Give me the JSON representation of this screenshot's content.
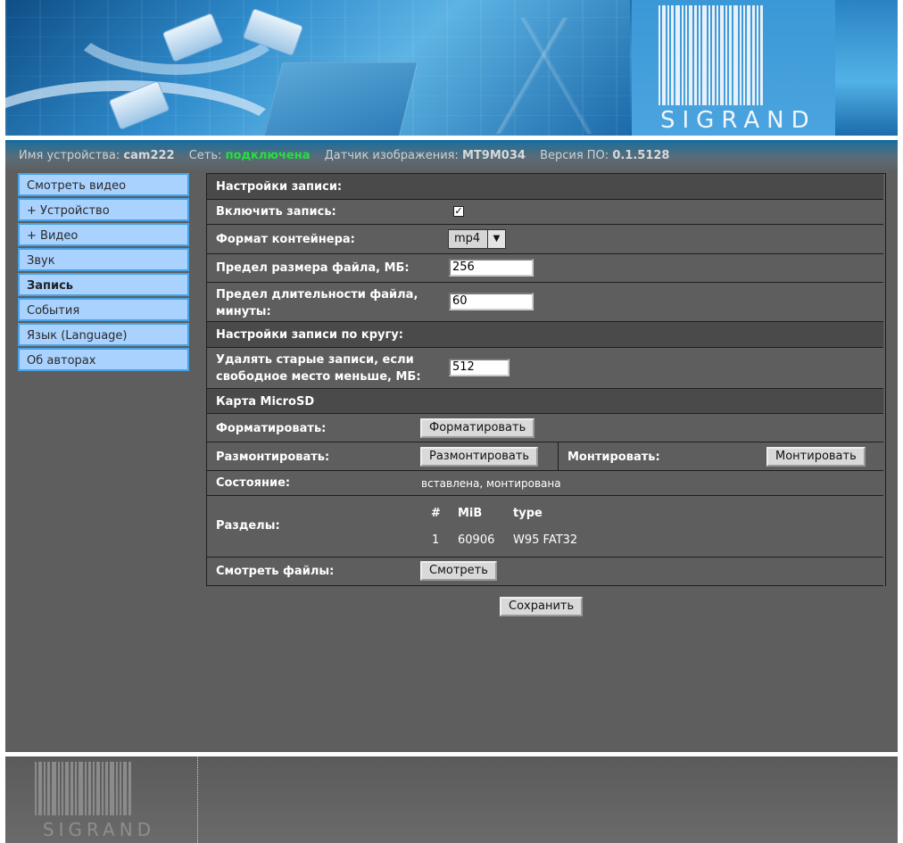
{
  "brand": {
    "logo_text": "SIGRAND"
  },
  "info_bar": {
    "device_label": "Имя устройства:",
    "device_value": "cam222",
    "network_label": "Сеть:",
    "network_value": "подключена",
    "sensor_label": "Датчик изображения:",
    "sensor_value": "MT9M034",
    "firmware_label": "Версия ПО:",
    "firmware_value": "0.1.5128",
    "network_status_color": "#22e23a"
  },
  "sidebar": {
    "items": [
      {
        "label": "Смотреть видео"
      },
      {
        "label": "+ Устройство"
      },
      {
        "label": "+ Видео"
      },
      {
        "label": "Звук"
      },
      {
        "label": "Запись",
        "active": true
      },
      {
        "label": "События"
      },
      {
        "label": "Язык (Language)"
      },
      {
        "label": "Об авторах"
      }
    ]
  },
  "record_settings": {
    "section_title": "Настройки записи:",
    "enable_label": "Включить запись:",
    "enable_checked": true,
    "enable_mark": "✓",
    "container_label": "Формат контейнера:",
    "container_value": "mp4",
    "container_arrow": "▼",
    "size_limit_label": "Предел размера файла, МБ:",
    "size_limit_value": "256",
    "duration_label_1": "Предел длительности файла,",
    "duration_label_2": "минуты:",
    "duration_value": "60"
  },
  "loop_settings": {
    "section_title": "Настройки записи по кругу:",
    "delete_label_1": "Удалять старые записи, если",
    "delete_label_2": "свободное место меньше, МБ:",
    "delete_value": "512"
  },
  "sd_card": {
    "section_title": "Карта MicroSD",
    "format_label": "Форматировать:",
    "format_button": "Форматировать",
    "unmount_label": "Размонтировать:",
    "unmount_button": "Размонтировать",
    "mount_label": "Монтировать:",
    "mount_button": "Монтировать",
    "state_label": "Состояние:",
    "state_value": "вставлена, монтирована",
    "partitions_label": "Разделы:",
    "partitions_headers": [
      "#",
      "MiB",
      "type"
    ],
    "partitions_rows": [
      [
        "1",
        "60906",
        "W95 FAT32"
      ]
    ],
    "files_label": "Смотреть файлы:",
    "files_button": "Смотреть"
  },
  "save_button": "Сохранить",
  "icons": {
    "checkbox": "checkmark-icon",
    "select_arrow": "chevron-down-icon",
    "logo": "barcode-logo-icon"
  }
}
